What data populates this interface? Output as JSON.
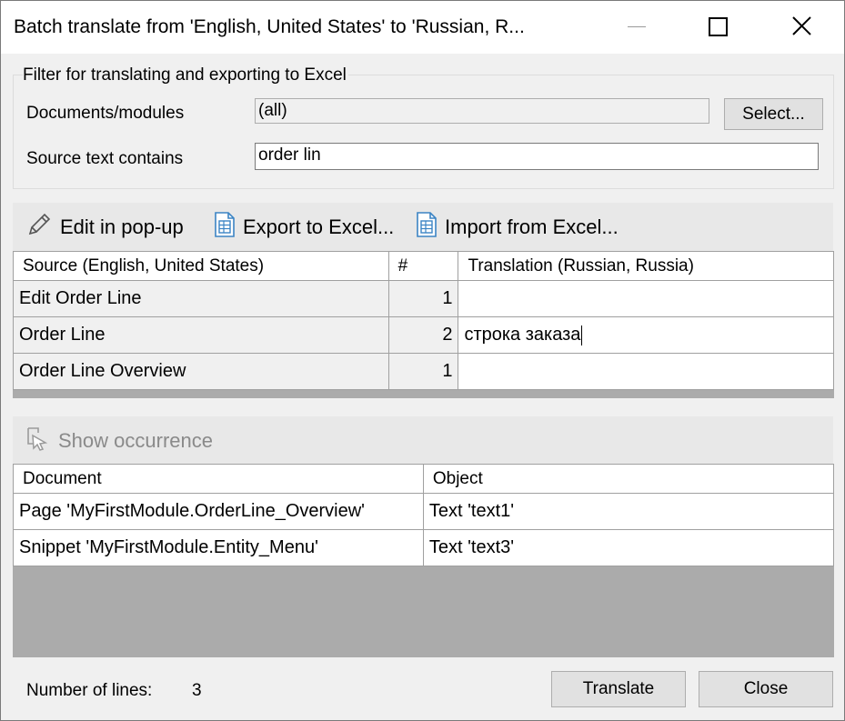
{
  "window": {
    "title": "Batch translate from 'English, United States' to 'Russian, R..."
  },
  "filter": {
    "group_title": "Filter for translating and exporting to Excel",
    "documents_label": "Documents/modules",
    "documents_value": "(all)",
    "select_button": "Select...",
    "source_text_label": "Source text contains",
    "source_text_value": "order lin"
  },
  "toolbar": {
    "edit_popup": "Edit in pop-up",
    "export_excel": "Export to Excel...",
    "import_excel": "Import from Excel..."
  },
  "translations": {
    "columns": [
      "Source (English, United States)",
      "#",
      "Translation (Russian, Russia)"
    ],
    "rows": [
      {
        "source": "Edit Order Line",
        "count": "1",
        "translation": ""
      },
      {
        "source": "Order Line",
        "count": "2",
        "translation": "строка заказа"
      },
      {
        "source": "Order Line Overview",
        "count": "1",
        "translation": ""
      }
    ]
  },
  "occurrence": {
    "show_occurrence": "Show occurrence",
    "columns": [
      "Document",
      "Object"
    ],
    "rows": [
      {
        "document": "Page 'MyFirstModule.OrderLine_Overview'",
        "object": "Text 'text1'"
      },
      {
        "document": "Snippet 'MyFirstModule.Entity_Menu'",
        "object": "Text 'text3'"
      }
    ]
  },
  "footer": {
    "lines_label": "Number of lines:",
    "lines_value": "3",
    "translate_button": "Translate",
    "close_button": "Close"
  },
  "icons": {
    "edit": "pencil-icon",
    "export": "spreadsheet-icon",
    "import": "spreadsheet-icon",
    "occurrence": "show-occurrence-icon",
    "minimize": "minimize-icon",
    "maximize": "maximize-icon",
    "close": "close-icon"
  },
  "colors": {
    "spreadsheet_icon": "#3b84c4",
    "disabled_text": "#8a8a8a",
    "grid_empty": "#ababab"
  }
}
